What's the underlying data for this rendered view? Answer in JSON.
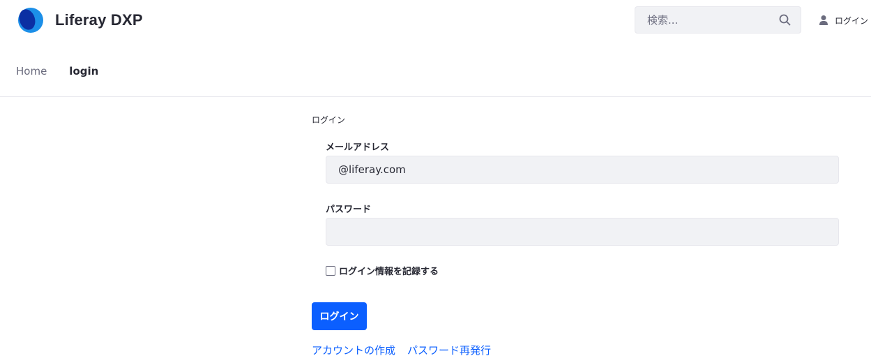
{
  "header": {
    "site_name": "Liferay DXP",
    "search_placeholder": "検索...",
    "user_login_label": "ログイン"
  },
  "nav": {
    "items": [
      {
        "label": "Home"
      },
      {
        "label": "login"
      }
    ]
  },
  "login_form": {
    "title": "ログイン",
    "email_label": "メールアドレス",
    "email_value": "@liferay.com",
    "password_label": "パスワード",
    "password_value": "",
    "remember_label": "ログイン情報を記録する",
    "remember_checked": false,
    "submit_label": "ログイン"
  },
  "links": {
    "create_account": "アカウントの作成",
    "forgot_password": "パスワード再発行"
  },
  "colors": {
    "accent": "#0b5fff",
    "logo_dark": "#0b2fa3",
    "logo_light": "#1c8fe8",
    "input_bg": "#f1f2f5",
    "text": "#272833",
    "muted": "#6b6c7e"
  }
}
